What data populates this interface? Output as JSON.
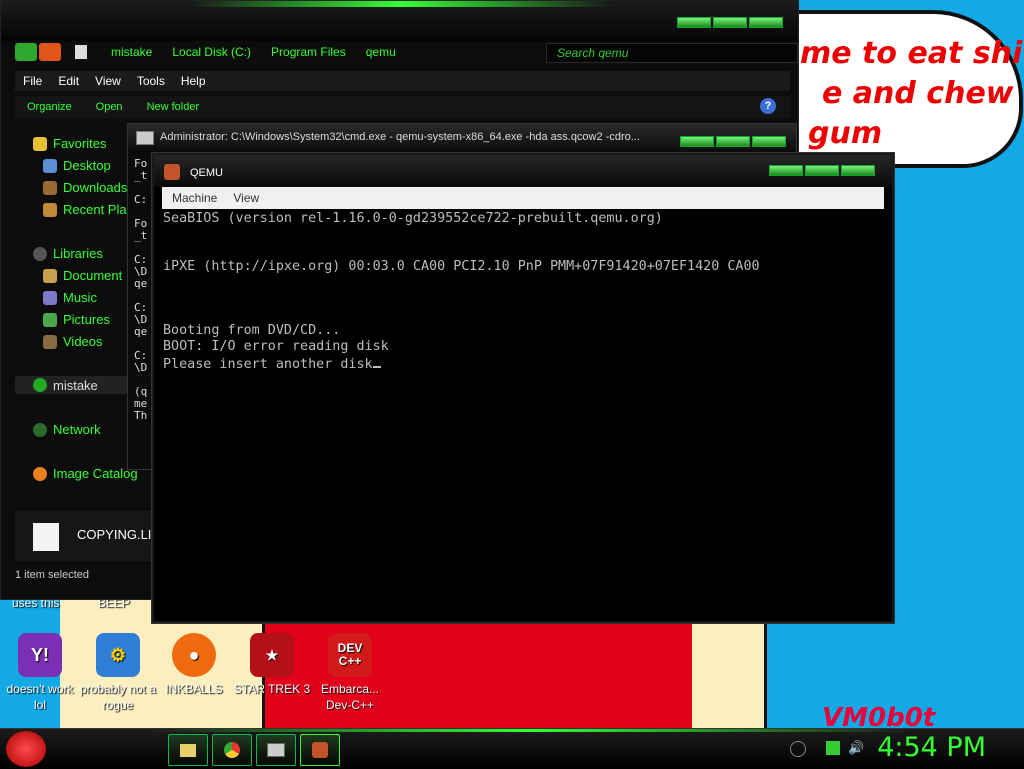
{
  "wallpaper": {
    "bubble_lines": [
      "me to eat shit",
      "e and chew",
      "gum"
    ],
    "watermark": "VM0b0t"
  },
  "explorer": {
    "breadcrumb": [
      "mistake",
      "Local Disk (C:)",
      "Program Files",
      "qemu"
    ],
    "search_placeholder": "Search qemu",
    "menu": [
      "File",
      "Edit",
      "View",
      "Tools",
      "Help"
    ],
    "commands": [
      "Organize",
      "Open",
      "New folder"
    ],
    "nav": {
      "favorites": "Favorites",
      "desktop": "Desktop",
      "downloads": "Downloads",
      "recent": "Recent Pla",
      "libraries": "Libraries",
      "documents": "Document",
      "music": "Music",
      "pictures": "Pictures",
      "videos": "Videos",
      "homegroup": "mistake",
      "network": "Network",
      "image_catalog": "Image Catalog"
    },
    "file_name": "COPYING.LI",
    "status": "1 item selected"
  },
  "cmd": {
    "title": "Administrator: C:\\Windows\\System32\\cmd.exe - qemu-system-x86_64.exe  -hda ass.qcow2 -cdro...",
    "lines": [
      "Fo",
      "_t",
      "",
      "C:",
      "",
      "Fo",
      "_t",
      "",
      "C:",
      "\\D",
      "qe",
      "",
      "C:",
      "\\D",
      "qe",
      "",
      "C:",
      "\\D",
      "",
      "(q",
      "me",
      "Th"
    ]
  },
  "qemu": {
    "title": "QEMU",
    "menu": [
      "Machine",
      "View"
    ],
    "screen_lines": [
      "SeaBIOS (version rel-1.16.0-0-gd239552ce722-prebuilt.qemu.org)",
      "",
      "",
      "iPXE (http://ipxe.org) 00:03.0 CA00 PCI2.10 PnP PMM+07F91420+07EF1420 CA00",
      "",
      "",
      "",
      "Booting from DVD/CD...",
      "BOOT: I/O error reading disk",
      "Please insert another disk"
    ]
  },
  "desktop": {
    "top_labels": [
      "uses this",
      "BEEP"
    ],
    "icons": [
      {
        "label": "doesn't work lol",
        "icon": "yahoo-messenger-icon",
        "color": "#7a2fb5"
      },
      {
        "label": "probably not a rogue",
        "icon": "gears-icon",
        "color": "#2f7fd6"
      },
      {
        "label": "INKBALLS",
        "icon": "ball-icon",
        "color": "#f06a10"
      },
      {
        "label": "STAR TREK 3",
        "icon": "star-wars-icon",
        "color": "#b3101a"
      },
      {
        "label": "Embarca... Dev-C++",
        "icon": "dev-cpp-icon",
        "color": "#d21a1a"
      }
    ],
    "dev_icon_text": "DEV C++"
  },
  "taskbar": {
    "clock": "4:54 PM"
  },
  "colors": {
    "accent_green": "#33ff33",
    "desktop_blue": "#12a9e6"
  }
}
